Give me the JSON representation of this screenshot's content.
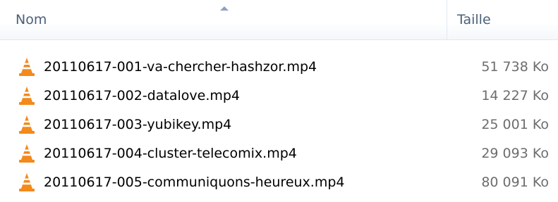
{
  "columns": {
    "name_label": "Nom",
    "size_label": "Taille",
    "sort_direction": "ascending"
  },
  "files": [
    {
      "name": "20110617-001-va-chercher-hashzor.mp4",
      "size": "51 738 Ko",
      "icon": "vlc-cone-icon"
    },
    {
      "name": "20110617-002-datalove.mp4",
      "size": "14 227 Ko",
      "icon": "vlc-cone-icon"
    },
    {
      "name": "20110617-003-yubikey.mp4",
      "size": "25 001 Ko",
      "icon": "vlc-cone-icon"
    },
    {
      "name": "20110617-004-cluster-telecomix.mp4",
      "size": "29 093 Ko",
      "icon": "vlc-cone-icon"
    },
    {
      "name": "20110617-005-communiquons-heureux.mp4",
      "size": "80 091 Ko",
      "icon": "vlc-cone-icon"
    }
  ],
  "colors": {
    "header_text": "#4c607a",
    "size_text": "#6d6d6d",
    "icon_orange": "#f28a1c",
    "icon_white": "#ffffff"
  }
}
